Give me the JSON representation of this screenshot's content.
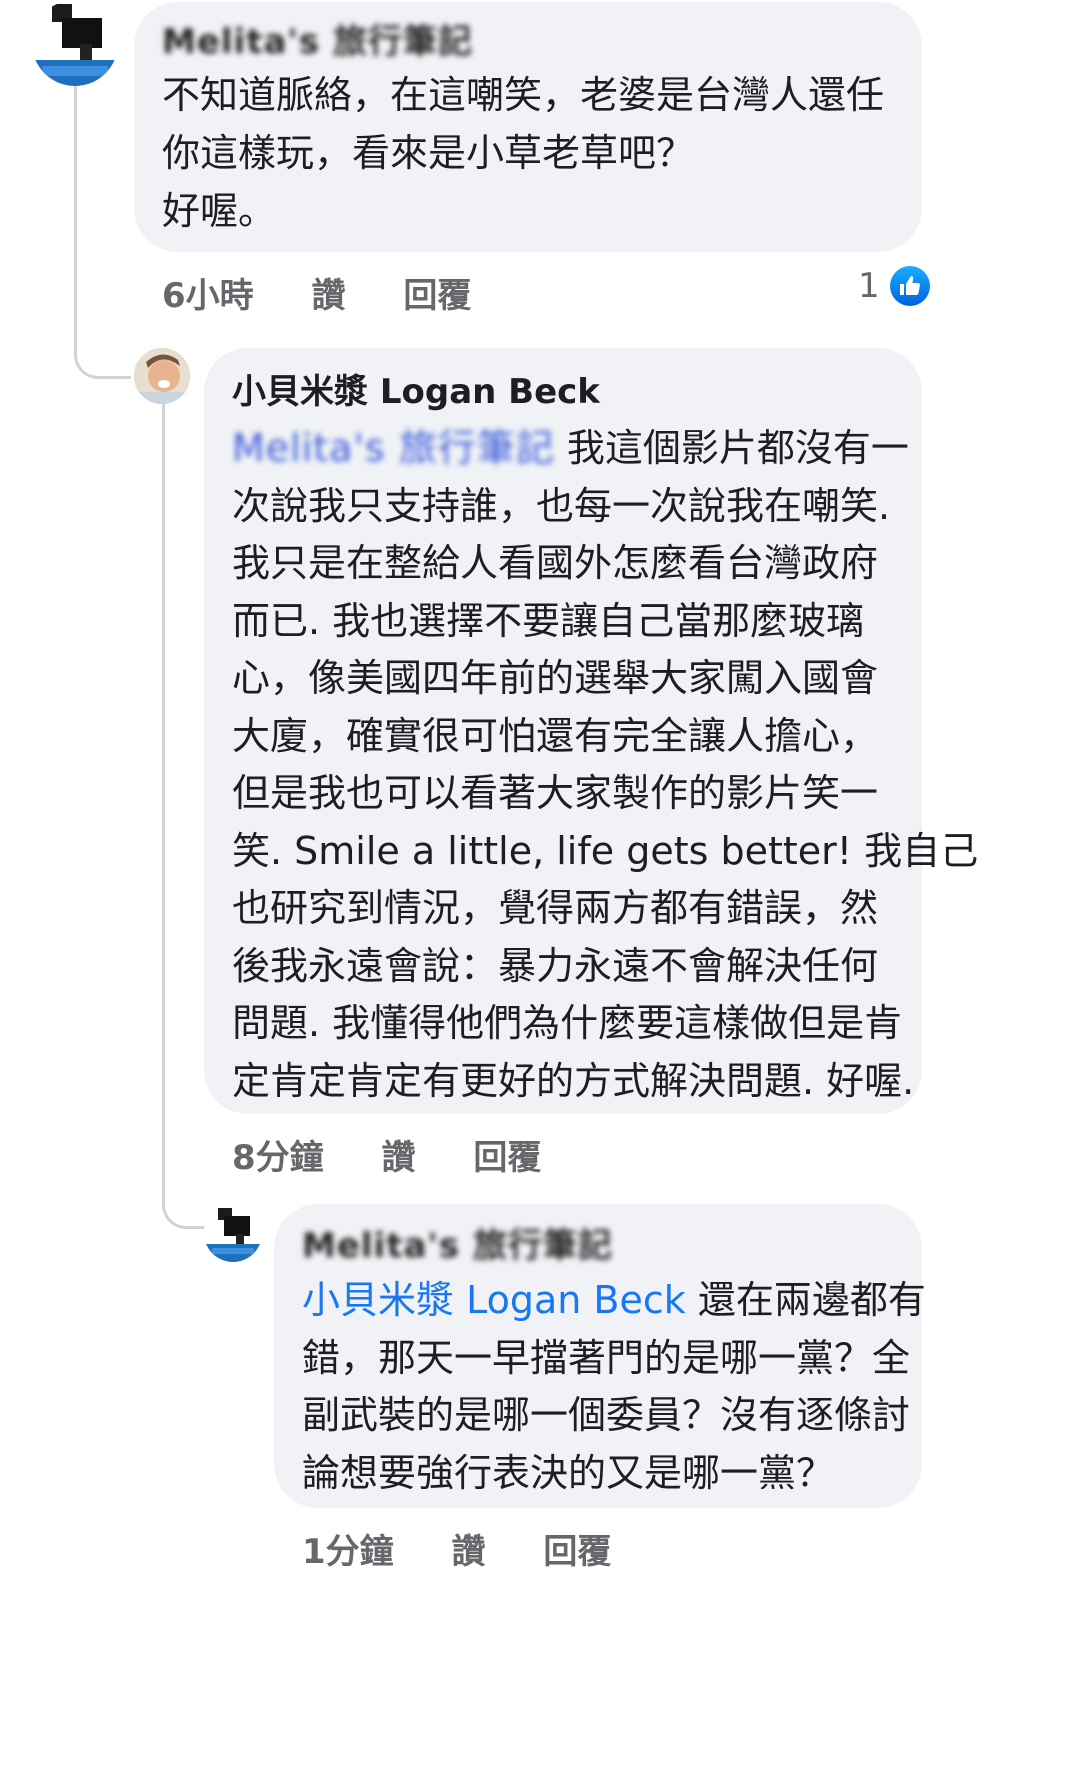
{
  "comments": [
    {
      "author": "Melita's 旅行筆記",
      "body_lines": [
        "不知道脈絡，在這嘲笑，老婆是台灣人還任",
        "你這樣玩，看來是小草老草吧？",
        "好喔。"
      ],
      "time": "6小時",
      "like_label": "讚",
      "reply_label": "回覆",
      "reaction_count": "1"
    },
    {
      "author": "小貝米漿 Logan Beck",
      "mention": "Melita's 旅行筆記",
      "body_first_line": " 我這個影片都沒有一",
      "body_lines": [
        "次說我只支持誰，也每一次說我在嘲笑.",
        "我只是在整給人看國外怎麼看台灣政府",
        "而已. 我也選擇不要讓自己當那麼玻璃",
        "心，像美國四年前的選舉大家闖入國會",
        "大廈，確實很可怕還有完全讓人擔心，",
        "但是我也可以看著大家製作的影片笑一",
        "笑. Smile a little, life gets better! 我自己",
        "也研究到情況，覺得兩方都有錯誤，然",
        "後我永遠會說：暴力永遠不會解決任何",
        "問題. 我懂得他們為什麼要這樣做但是肯",
        "定肯定肯定有更好的方式解決問題. 好喔."
      ],
      "time": "8分鐘",
      "like_label": "讚",
      "reply_label": "回覆"
    },
    {
      "author": "Melita's 旅行筆記",
      "mention": "小貝米漿 Logan Beck",
      "body_first_line": " 還在兩邊都有",
      "body_lines": [
        "錯，那天一早擋著門的是哪一黨？全",
        "副武裝的是哪一個委員？沒有逐條討",
        "論想要強行表決的又是哪一黨？"
      ],
      "time": "1分鐘",
      "like_label": "讚",
      "reply_label": "回覆"
    }
  ],
  "colors": {
    "bubble": "#f0f2f5",
    "mention": "#1877f2",
    "meta": "#65676b",
    "like": "#0a7cff"
  }
}
